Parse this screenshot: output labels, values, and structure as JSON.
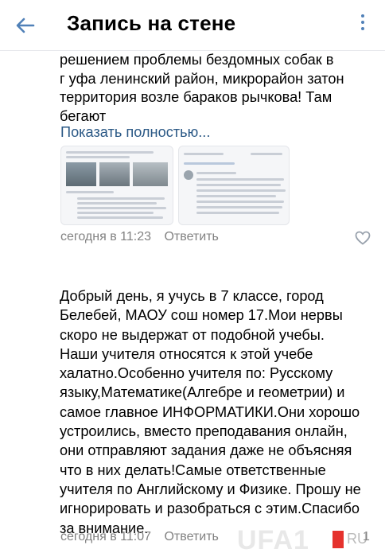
{
  "header": {
    "title": "Запись на стене"
  },
  "post1": {
    "lines": [
      "решением проблемы бездомных собак в",
      "г уфа ленинский район, микрорайон затон",
      "территория возле бараков рычкова! Там",
      "бегают"
    ],
    "show_more": "Показать полностью...",
    "time": "сегодня в 11:23",
    "reply": "Ответить"
  },
  "post2": {
    "lines": [
      "Добрый день, я учусь в 7 классе, город",
      "Белебей, МАОУ сош номер 17.Мои нервы",
      "скоро не выдержат от подобной учебы.",
      "Наши учителя относятся к этой учебе",
      "халатно.Особенно учителя по: Русскому",
      "языку,Математике(Алгебре и геометрии) и",
      "самое главное ИНФОРМАТИКИ.Они хорошо",
      "устроились, вместо преподавания онлайн,",
      "они отправляют задания даже не объясняя",
      "что в них делать!Самые ответственные",
      "учителя по Английскому и Физике. Прошу не",
      "игнорировать и разобраться с этим.Спасибо",
      "за внимание."
    ],
    "time": "сегодня в 11:07",
    "reply": "Ответить",
    "like_count": "1"
  },
  "watermark": {
    "text": "UFA1",
    "suffix": "RU"
  },
  "colors": {
    "link": "#2a5885",
    "accent": "#5181b8",
    "meta": "#828282",
    "heart": "#99a2ad"
  }
}
